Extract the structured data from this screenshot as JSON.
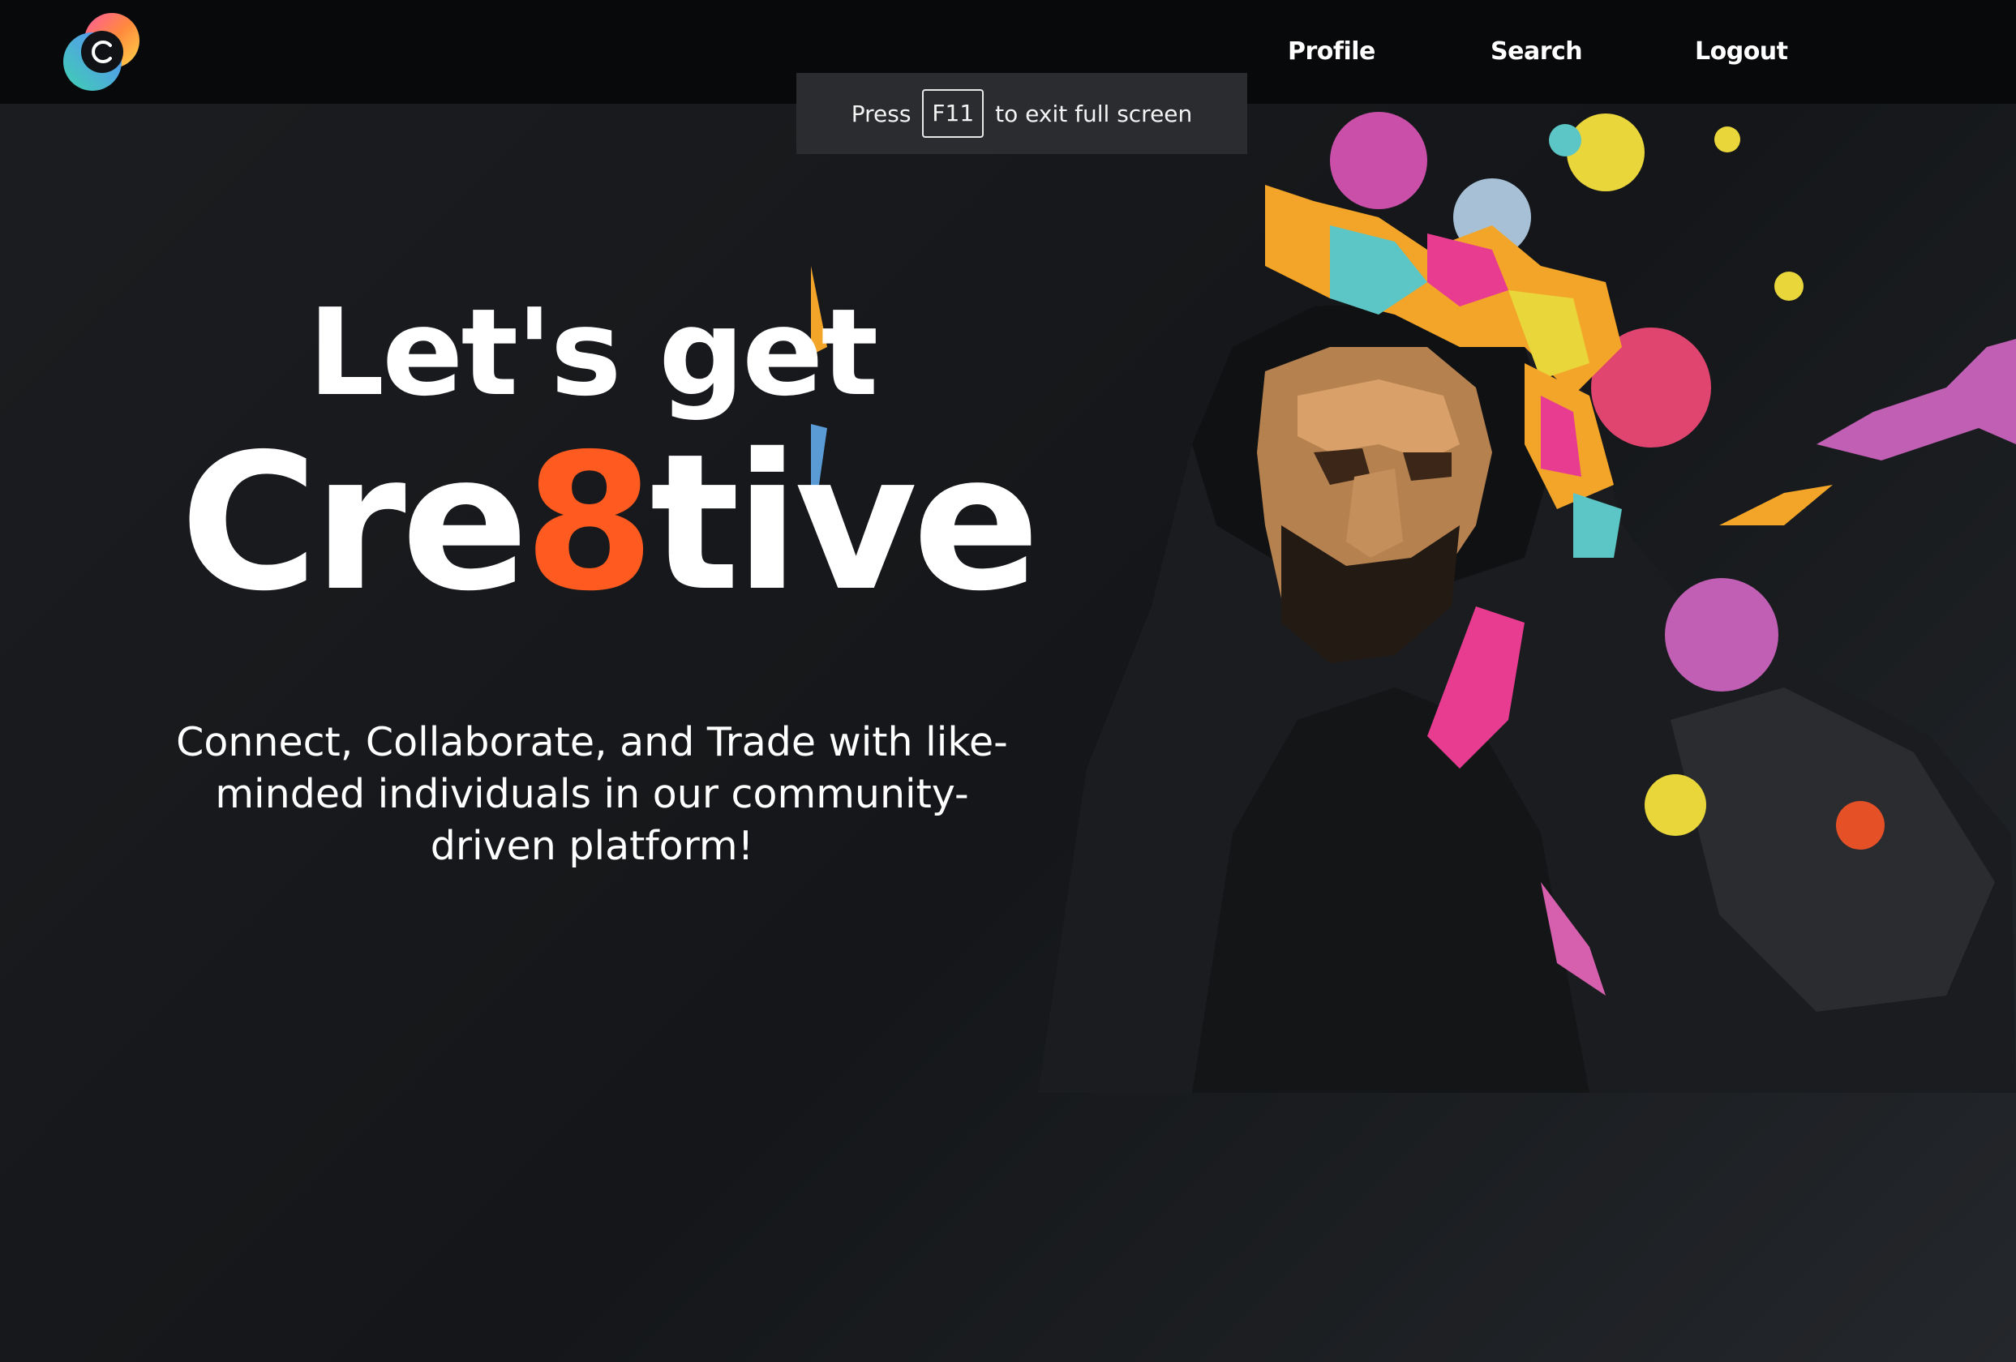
{
  "navbar": {
    "logo_icon": "cre8tive-logo-icon",
    "links": [
      {
        "label": "Profile"
      },
      {
        "label": "Search"
      },
      {
        "label": "Logout"
      }
    ]
  },
  "fullscreen_notice": {
    "prefix": "Press",
    "key": "F11",
    "suffix": "to exit full screen"
  },
  "hero": {
    "line1": "Let's get",
    "line2_part1": "Cre",
    "line2_accent": "8",
    "line2_part2": "tive",
    "tagline": "Connect, Collaborate, and Trade with like-minded individuals in our community-driven platform!",
    "image_icon": "hooded-man-color-splash-illustration"
  },
  "colors": {
    "background": "#17191c",
    "navbar": "#08090b",
    "accent": "#ff5a1f",
    "text": "#ffffff"
  }
}
